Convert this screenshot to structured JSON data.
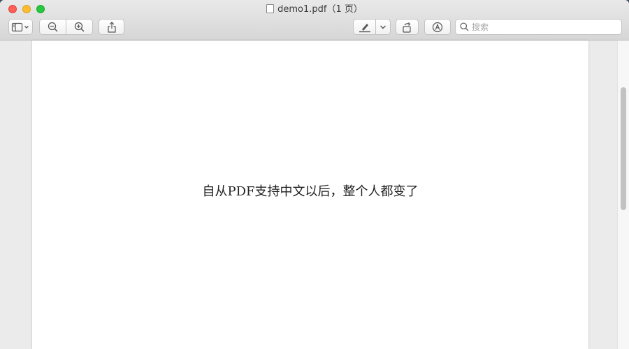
{
  "window": {
    "title": "demo1.pdf（1 页）"
  },
  "toolbar": {
    "sidebar_icon": "sidebar-icon",
    "zoom_out_icon": "zoom-out-icon",
    "zoom_in_icon": "zoom-in-icon",
    "share_icon": "share-icon",
    "markup_icon": "pen-icon",
    "rotate_icon": "rotate-icon",
    "annotate_icon": "annotate-icon"
  },
  "search": {
    "placeholder": "搜索"
  },
  "document": {
    "text": "自从PDF支持中文以后，整个人都变了"
  }
}
